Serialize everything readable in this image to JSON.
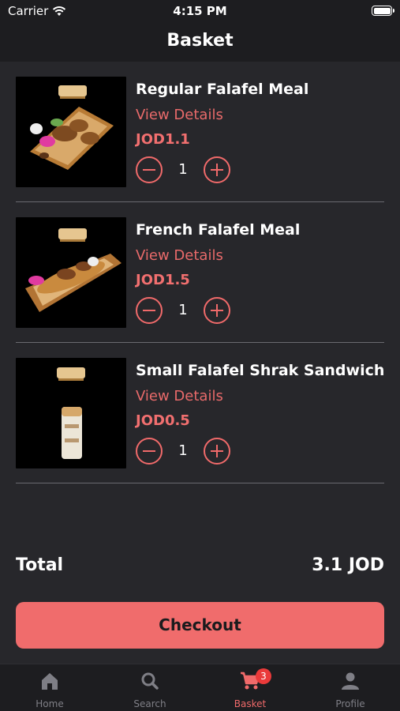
{
  "status_bar": {
    "carrier": "Carrier",
    "time": "4:15 PM"
  },
  "nav": {
    "title": "Basket"
  },
  "items": [
    {
      "name": "Regular Falafel Meal",
      "details_link": "View Details",
      "price": "JOD1.1",
      "quantity": "1",
      "image_icon": "falafel-platter-image"
    },
    {
      "name": "French Falafel Meal",
      "details_link": "View Details",
      "price": "JOD1.5",
      "quantity": "1",
      "image_icon": "falafel-baguette-image"
    },
    {
      "name": "Small Falafel Shrak Sandwich",
      "details_link": "View Details",
      "price": "JOD0.5",
      "quantity": "1",
      "image_icon": "wrap-sandwich-image"
    }
  ],
  "total": {
    "label": "Total",
    "value": "3.1 JOD"
  },
  "checkout": {
    "label": "Checkout"
  },
  "tab_bar": {
    "tabs": [
      {
        "label": "Home",
        "icon": "home-icon",
        "active": false
      },
      {
        "label": "Search",
        "icon": "search-icon",
        "active": false
      },
      {
        "label": "Basket",
        "icon": "cart-icon",
        "active": true,
        "badge": "3"
      },
      {
        "label": "Profile",
        "icon": "person-icon",
        "active": false
      }
    ]
  },
  "colors": {
    "accent": "#f06c6c",
    "background": "#27272b",
    "bar": "#1d1d20",
    "badge": "#ea3a3a"
  }
}
